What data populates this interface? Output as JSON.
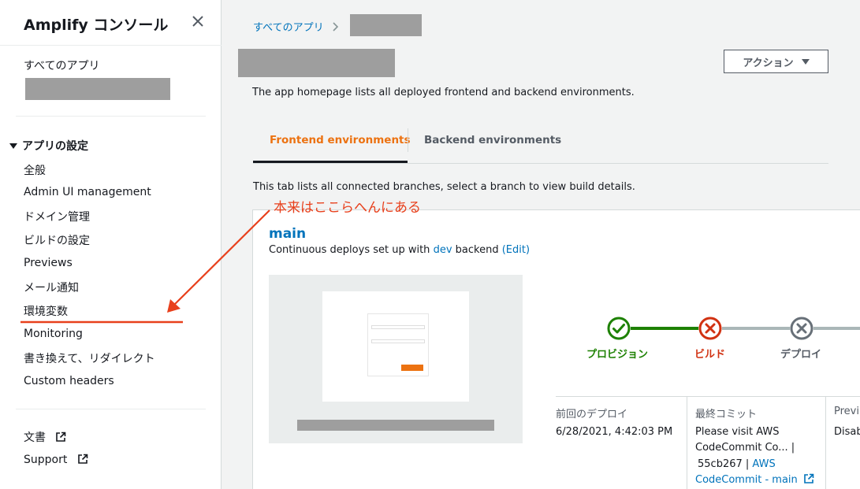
{
  "sidebar": {
    "title": "Amplify コンソール",
    "all_apps": "すべてのアプリ",
    "section_title": "アプリの設定",
    "items": [
      "全般",
      "Admin UI management",
      "ドメイン管理",
      "ビルドの設定",
      "Previews",
      "メール通知",
      "環境変数",
      "Monitoring",
      "書き換えて、リダイレクト",
      "Custom headers"
    ],
    "docs": "文書",
    "support": "Support"
  },
  "breadcrumb": {
    "root": "すべてのアプリ"
  },
  "header": {
    "action_label": "アクション",
    "description": "The app homepage lists all deployed frontend and backend environments."
  },
  "tabs": [
    {
      "label": "Frontend environments",
      "active": true
    },
    {
      "label": "Backend environments",
      "active": false
    }
  ],
  "tab_description": "This tab lists all connected branches, select a branch to view build details.",
  "branch": {
    "name": "main",
    "cont_prefix": "Continuous deploys set up with",
    "backend": "dev",
    "cont_suffix": "backend",
    "edit": "(Edit)"
  },
  "pipeline": {
    "steps": [
      {
        "label": "プロビジョン",
        "status": "success",
        "color": "#1d8102"
      },
      {
        "label": "ビルド",
        "status": "failed",
        "color": "#d13212"
      },
      {
        "label": "デプロイ",
        "status": "cancelled",
        "color": "#687078"
      }
    ]
  },
  "info": {
    "last_deploy_label": "前回のデプロイ",
    "last_deploy_value": "6/28/2021, 4:42:03 PM",
    "last_commit_label": "最終コミット",
    "commit_line1": "Please visit AWS",
    "commit_line2": "CodeCommit Co... |",
    "commit_hash": "55cb267 |",
    "commit_link_part1": "AWS",
    "commit_link_part2": "CodeCommit - main",
    "preview_label": "Previ",
    "preview_value": "Disab"
  },
  "annotation": {
    "text": "本来はここらへんにある",
    "color": "#e8401c"
  }
}
